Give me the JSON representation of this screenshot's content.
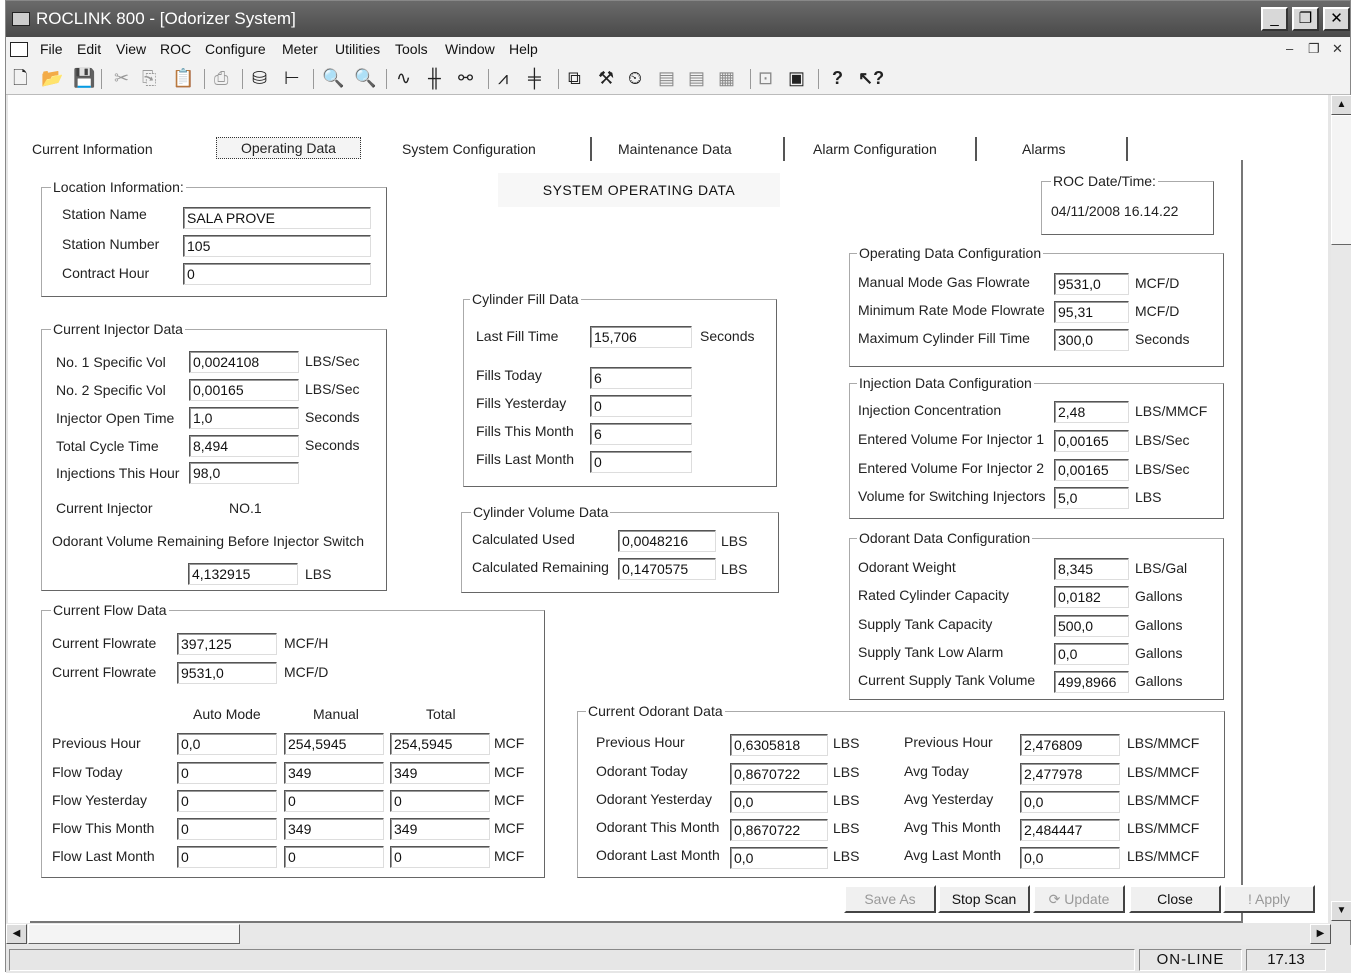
{
  "window": {
    "title": "ROCLINK 800 - [Odorizer System]"
  },
  "menu": [
    "File",
    "Edit",
    "View",
    "ROC",
    "Configure",
    "Meter",
    "Utilities",
    "Tools",
    "Window",
    "Help"
  ],
  "tabs": [
    "Current Information",
    "Operating Data",
    "System Configuration",
    "Maintenance Data",
    "Alarm Configuration",
    "Alarms"
  ],
  "header": "SYSTEM OPERATING DATA",
  "location": {
    "title": "Location Information:",
    "station_name_label": "Station Name",
    "station_name": "SALA PROVE",
    "station_number_label": "Station Number",
    "station_number": "105",
    "contract_hour_label": "Contract Hour",
    "contract_hour": "0"
  },
  "roc_date": {
    "title": "ROC Date/Time:",
    "value": "04/11/2008 16.14.22"
  },
  "injector": {
    "title": "Current Injector Data",
    "rows": [
      {
        "label": "No. 1 Specific Vol",
        "value": "0,0024108",
        "unit": "LBS/Sec"
      },
      {
        "label": "No. 2 Specific Vol",
        "value": "0,00165",
        "unit": "LBS/Sec"
      },
      {
        "label": "Injector Open Time",
        "value": "1,0",
        "unit": "Seconds"
      },
      {
        "label": "Total Cycle Time",
        "value": "8,494",
        "unit": "Seconds"
      },
      {
        "label": "Injections This Hour",
        "value": "98,0",
        "unit": ""
      }
    ],
    "current_label": "Current Injector",
    "current_value": "NO.1",
    "remaining_label": "Odorant Volume Remaining Before Injector Switch",
    "remaining_value": "4,132915",
    "remaining_unit": "LBS"
  },
  "cylinder_fill": {
    "title": "Cylinder Fill Data",
    "last_fill_label": "Last Fill Time",
    "last_fill": "15,706",
    "last_fill_unit": "Seconds",
    "rows": [
      {
        "label": "Fills Today",
        "value": "6"
      },
      {
        "label": "Fills Yesterday",
        "value": "0"
      },
      {
        "label": "Fills This Month",
        "value": "6"
      },
      {
        "label": "Fills Last Month",
        "value": "0"
      }
    ]
  },
  "cylinder_volume": {
    "title": "Cylinder Volume Data",
    "rows": [
      {
        "label": "Calculated Used",
        "value": "0,0048216",
        "unit": "LBS"
      },
      {
        "label": "Calculated Remaining",
        "value": "0,1470575",
        "unit": "LBS"
      }
    ]
  },
  "op_config": {
    "title": "Operating Data Configuration",
    "rows": [
      {
        "label": "Manual Mode Gas Flowrate",
        "value": "9531,0",
        "unit": "MCF/D"
      },
      {
        "label": "Minimum Rate Mode Flowrate",
        "value": "95,31",
        "unit": "MCF/D"
      },
      {
        "label": "Maximum Cylinder Fill Time",
        "value": "300,0",
        "unit": "Seconds"
      }
    ]
  },
  "inj_config": {
    "title": "Injection Data Configuration",
    "rows": [
      {
        "label": "Injection Concentration",
        "value": "2,48",
        "unit": "LBS/MMCF"
      },
      {
        "label": "Entered Volume For Injector 1",
        "value": "0,00165",
        "unit": "LBS/Sec"
      },
      {
        "label": "Entered Volume For Injector 2",
        "value": "0,00165",
        "unit": "LBS/Sec"
      },
      {
        "label": "Volume for Switching Injectors",
        "value": "5,0",
        "unit": "LBS"
      }
    ]
  },
  "odor_config": {
    "title": "Odorant Data Configuration",
    "rows": [
      {
        "label": "Odorant Weight",
        "value": "8,345",
        "unit": "LBS/Gal"
      },
      {
        "label": "Rated Cylinder Capacity",
        "value": "0,0182",
        "unit": "Gallons"
      },
      {
        "label": "Supply Tank Capacity",
        "value": "500,0",
        "unit": "Gallons"
      },
      {
        "label": "Supply Tank Low Alarm",
        "value": "0,0",
        "unit": "Gallons"
      },
      {
        "label": "Current Supply Tank Volume",
        "value": "499,8966",
        "unit": "Gallons"
      }
    ]
  },
  "flow": {
    "title": "Current Flow Data",
    "rate_label": "Current Flowrate",
    "rate_h": "397,125",
    "rate_h_unit": "MCF/H",
    "rate_d": "9531,0",
    "rate_d_unit": "MCF/D",
    "col_auto": "Auto Mode",
    "col_manual": "Manual",
    "col_total": "Total",
    "unit": "MCF",
    "rows": [
      {
        "label": "Previous Hour",
        "auto": "0,0",
        "manual": "254,5945",
        "total": "254,5945"
      },
      {
        "label": "Flow Today",
        "auto": "0",
        "manual": "349",
        "total": "349"
      },
      {
        "label": "Flow Yesterday",
        "auto": "0",
        "manual": "0",
        "total": "0"
      },
      {
        "label": "Flow This Month",
        "auto": "0",
        "manual": "349",
        "total": "349"
      },
      {
        "label": "Flow Last Month",
        "auto": "0",
        "manual": "0",
        "total": "0"
      }
    ]
  },
  "odorant": {
    "title": "Current Odorant Data",
    "left": [
      {
        "label": "Previous Hour",
        "value": "0,6305818",
        "unit": "LBS"
      },
      {
        "label": "Odorant Today",
        "value": "0,8670722",
        "unit": "LBS"
      },
      {
        "label": "Odorant Yesterday",
        "value": "0,0",
        "unit": "LBS"
      },
      {
        "label": "Odorant This Month",
        "value": "0,8670722",
        "unit": "LBS"
      },
      {
        "label": "Odorant Last Month",
        "value": "0,0",
        "unit": "LBS"
      }
    ],
    "right": [
      {
        "label": "Previous Hour",
        "value": "2,476809",
        "unit": "LBS/MMCF"
      },
      {
        "label": "Avg Today",
        "value": "2,477978",
        "unit": "LBS/MMCF"
      },
      {
        "label": "Avg Yesterday",
        "value": "0,0",
        "unit": "LBS/MMCF"
      },
      {
        "label": "Avg This Month",
        "value": "2,484447",
        "unit": "LBS/MMCF"
      },
      {
        "label": "Avg Last Month",
        "value": "0,0",
        "unit": "LBS/MMCF"
      }
    ]
  },
  "buttons": {
    "save_as": "Save As",
    "stop_scan": "Stop Scan",
    "update": "Update",
    "close": "Close",
    "apply": "Apply"
  },
  "status": {
    "mode": "ON-LINE",
    "time": "17.13"
  }
}
